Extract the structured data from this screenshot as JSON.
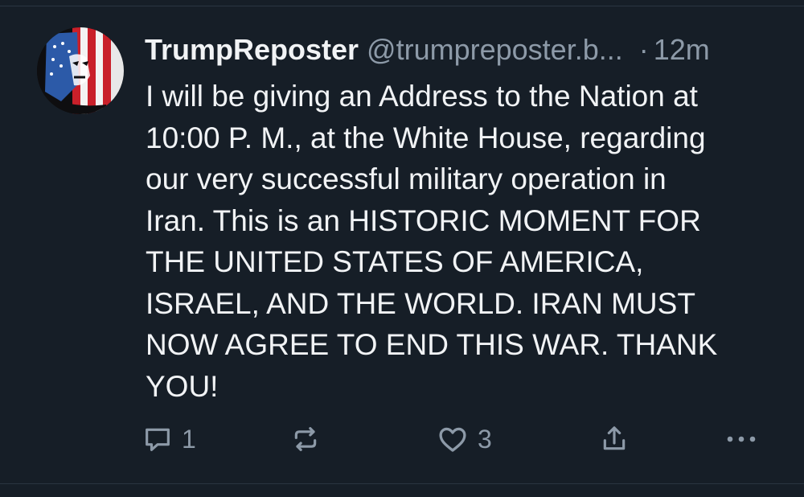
{
  "post": {
    "author": {
      "display_name": "TrumpReposter",
      "handle": "@trumpreposter.b...",
      "avatar_icon": "avatar-flag-face"
    },
    "separator": "·",
    "timestamp": "12m",
    "text": "I will be giving an Address to the Nation at\n10:00 P. M., at the White House, regarding\nour very successful military operation in\nIran. This is an HISTORIC MOMENT FOR\nTHE UNITED STATES OF AMERICA,\nISRAEL, AND THE WORLD. IRAN MUST\nNOW AGREE TO END THIS WAR. THANK\nYOU!",
    "actions": {
      "reply": {
        "icon": "reply-icon",
        "count": "1"
      },
      "repost": {
        "icon": "repost-icon",
        "count": ""
      },
      "like": {
        "icon": "heart-icon",
        "count": "3"
      },
      "share": {
        "icon": "share-icon"
      },
      "more": {
        "icon": "more-icon"
      }
    }
  },
  "colors": {
    "background": "#161e27",
    "text": "#f1f3f5",
    "muted": "#8d9aa8",
    "divider": "#2a3541"
  }
}
